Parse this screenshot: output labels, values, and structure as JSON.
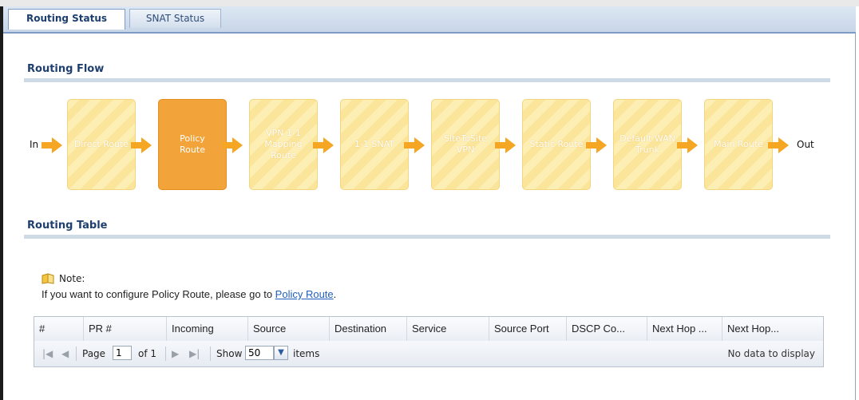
{
  "tabs": [
    {
      "label": "Routing Status",
      "active": true
    },
    {
      "label": "SNAT Status",
      "active": false
    }
  ],
  "routing_flow": {
    "title": "Routing Flow",
    "in_label": "In",
    "out_label": "Out",
    "steps": [
      {
        "label": "Direct Route",
        "active": false
      },
      {
        "label": "Policy\nRoute",
        "active": true
      },
      {
        "label": "VPN 1-1\nMapping\nRoute",
        "active": false
      },
      {
        "label": "1-1 SNAT",
        "active": false
      },
      {
        "label": "SiteToSite\nVPN",
        "active": false
      },
      {
        "label": "Static Route",
        "active": false
      },
      {
        "label": "Default WAN\nTrunk",
        "active": false
      },
      {
        "label": "Main Route",
        "active": false
      }
    ]
  },
  "routing_table": {
    "title": "Routing Table",
    "note_label": "Note:",
    "note_text": "If you want to configure Policy Route, please go to ",
    "note_link": "Policy Route",
    "note_suffix": ".",
    "columns": [
      "#",
      "PR #",
      "Incoming",
      "Source",
      "Destination",
      "Service",
      "Source Port",
      "DSCP Co...",
      "Next Hop ...",
      "Next Hop..."
    ],
    "pager": {
      "page_label": "Page",
      "page_value": "1",
      "of_label": "of 1",
      "show_label": "Show",
      "show_value": "50",
      "items_label": "items",
      "empty_text": "No data to display"
    }
  },
  "colors": {
    "accent": "#1f3f6f",
    "flow_active": "#f2a33a",
    "flow_inactive": "#fdeeb3",
    "arrow": "#f5a623"
  }
}
